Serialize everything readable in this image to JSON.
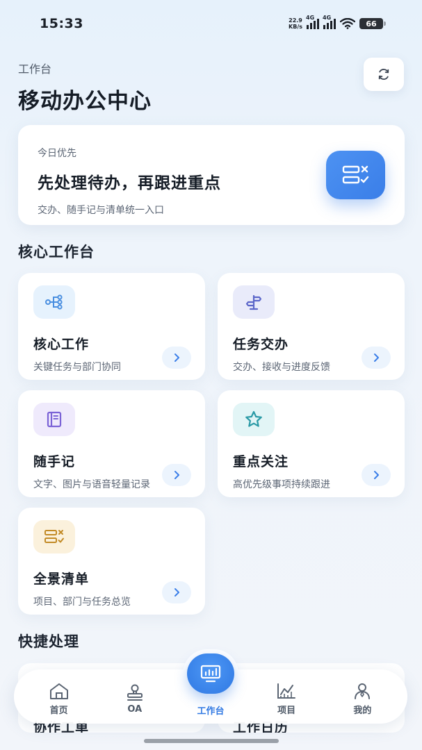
{
  "status": {
    "time": "15:33",
    "netspeed_value": "22.9",
    "netspeed_unit": "KB/s",
    "signal1_tag": "4G",
    "signal2_tag": "4G",
    "battery": "66"
  },
  "header": {
    "subtitle": "工作台",
    "title": "移动办公中心",
    "refresh_icon": "refresh-icon"
  },
  "priority": {
    "label": "今日优先",
    "title": "先处理待办，再跟进重点",
    "desc": "交办、随手记与清单统一入口",
    "icon": "checklist-icon",
    "accent": "#3a7ee8"
  },
  "core": {
    "section_title": "核心工作台",
    "tiles": [
      {
        "title": "核心工作",
        "desc": "关键任务与部门协同",
        "icon": "flow-icon",
        "bg": "#e6f2fd",
        "fg": "#4a8fe0"
      },
      {
        "title": "任务交办",
        "desc": "交办、接收与进度反馈",
        "icon": "signpost-icon",
        "bg": "#e9ebfa",
        "fg": "#5b66c9"
      },
      {
        "title": "随手记",
        "desc": "文字、图片与语音轻量记录",
        "icon": "notebook-icon",
        "bg": "#efeafc",
        "fg": "#7b63d6"
      },
      {
        "title": "重点关注",
        "desc": "高优先级事项持续跟进",
        "icon": "star-icon",
        "bg": "#e2f5f6",
        "fg": "#2a9aa6"
      },
      {
        "title": "全景清单",
        "desc": "项目、部门与任务总览",
        "icon": "list-check-icon",
        "bg": "#fbf1dc",
        "fg": "#c28a25"
      }
    ]
  },
  "quick": {
    "section_title": "快捷处理",
    "items": [
      {
        "title": "协作工单"
      },
      {
        "title": "工作日历"
      }
    ]
  },
  "tabbar": {
    "items": [
      {
        "label": "首页",
        "icon": "home-icon"
      },
      {
        "label": "OA",
        "icon": "stamp-icon"
      },
      {
        "label": "工作台",
        "icon": "monitor-chart-icon"
      },
      {
        "label": "项目",
        "icon": "line-chart-icon"
      },
      {
        "label": "我的",
        "icon": "user-icon"
      }
    ],
    "active_color": "#2f78e3"
  }
}
